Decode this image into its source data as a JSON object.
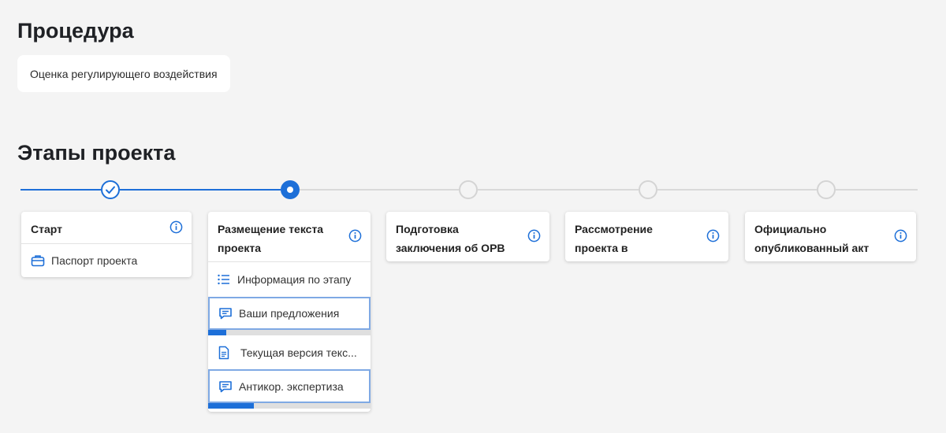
{
  "procedure": {
    "title": "Процедура",
    "value": "Оценка регулирующего воздействия"
  },
  "stages_title": "Этапы проекта",
  "stages": [
    {
      "status": "done",
      "title": "Старт",
      "items": [
        {
          "icon": "briefcase-icon",
          "label": "Паспорт проекта"
        }
      ]
    },
    {
      "status": "current",
      "title": "Размещение текста проекта",
      "items": [
        {
          "icon": "list-icon",
          "label": "Информация по этапу"
        },
        {
          "icon": "chat-icon",
          "label": "Ваши предложения",
          "progress": 0.11
        },
        {
          "icon": "document-icon",
          "label": "Текущая версия текс..."
        },
        {
          "icon": "chat-icon",
          "label": "Антикор. экспертиза",
          "progress": 0.28
        }
      ]
    },
    {
      "status": "todo",
      "title": "Подготовка заключения об ОРВ",
      "items": []
    },
    {
      "status": "todo",
      "title": "Рассмотрение проекта в Правительстве РФ",
      "items": []
    },
    {
      "status": "todo",
      "title": "Официально опубликованный акт",
      "items": []
    }
  ],
  "colors": {
    "accent": "#1d6fd8",
    "inactive": "#d4d4d4",
    "background": "#f4f4f4"
  }
}
